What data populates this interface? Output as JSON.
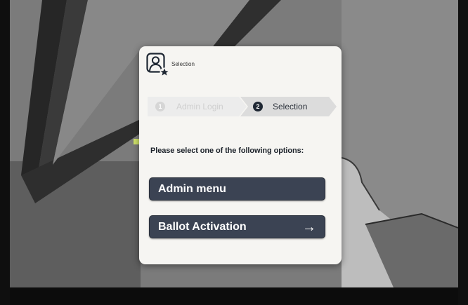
{
  "header": {
    "icon": "admin-user-star-icon",
    "title": "Selection"
  },
  "stepper": {
    "steps": [
      {
        "number": "1",
        "label": "Admin Login",
        "state": "completed"
      },
      {
        "number": "2",
        "label": "Selection",
        "state": "active"
      }
    ]
  },
  "instruction": "Please select one of the following options:",
  "options": {
    "admin_menu": {
      "label": "Admin menu"
    },
    "ballot_activation": {
      "label": "Ballot Activation",
      "icon": "arrow-right-icon"
    }
  },
  "colors": {
    "button_bg": "#3b4353",
    "dialog_bg": "#f6f5f2",
    "active_step": "#1e2733",
    "inactive_step": "#d6d6d6"
  }
}
